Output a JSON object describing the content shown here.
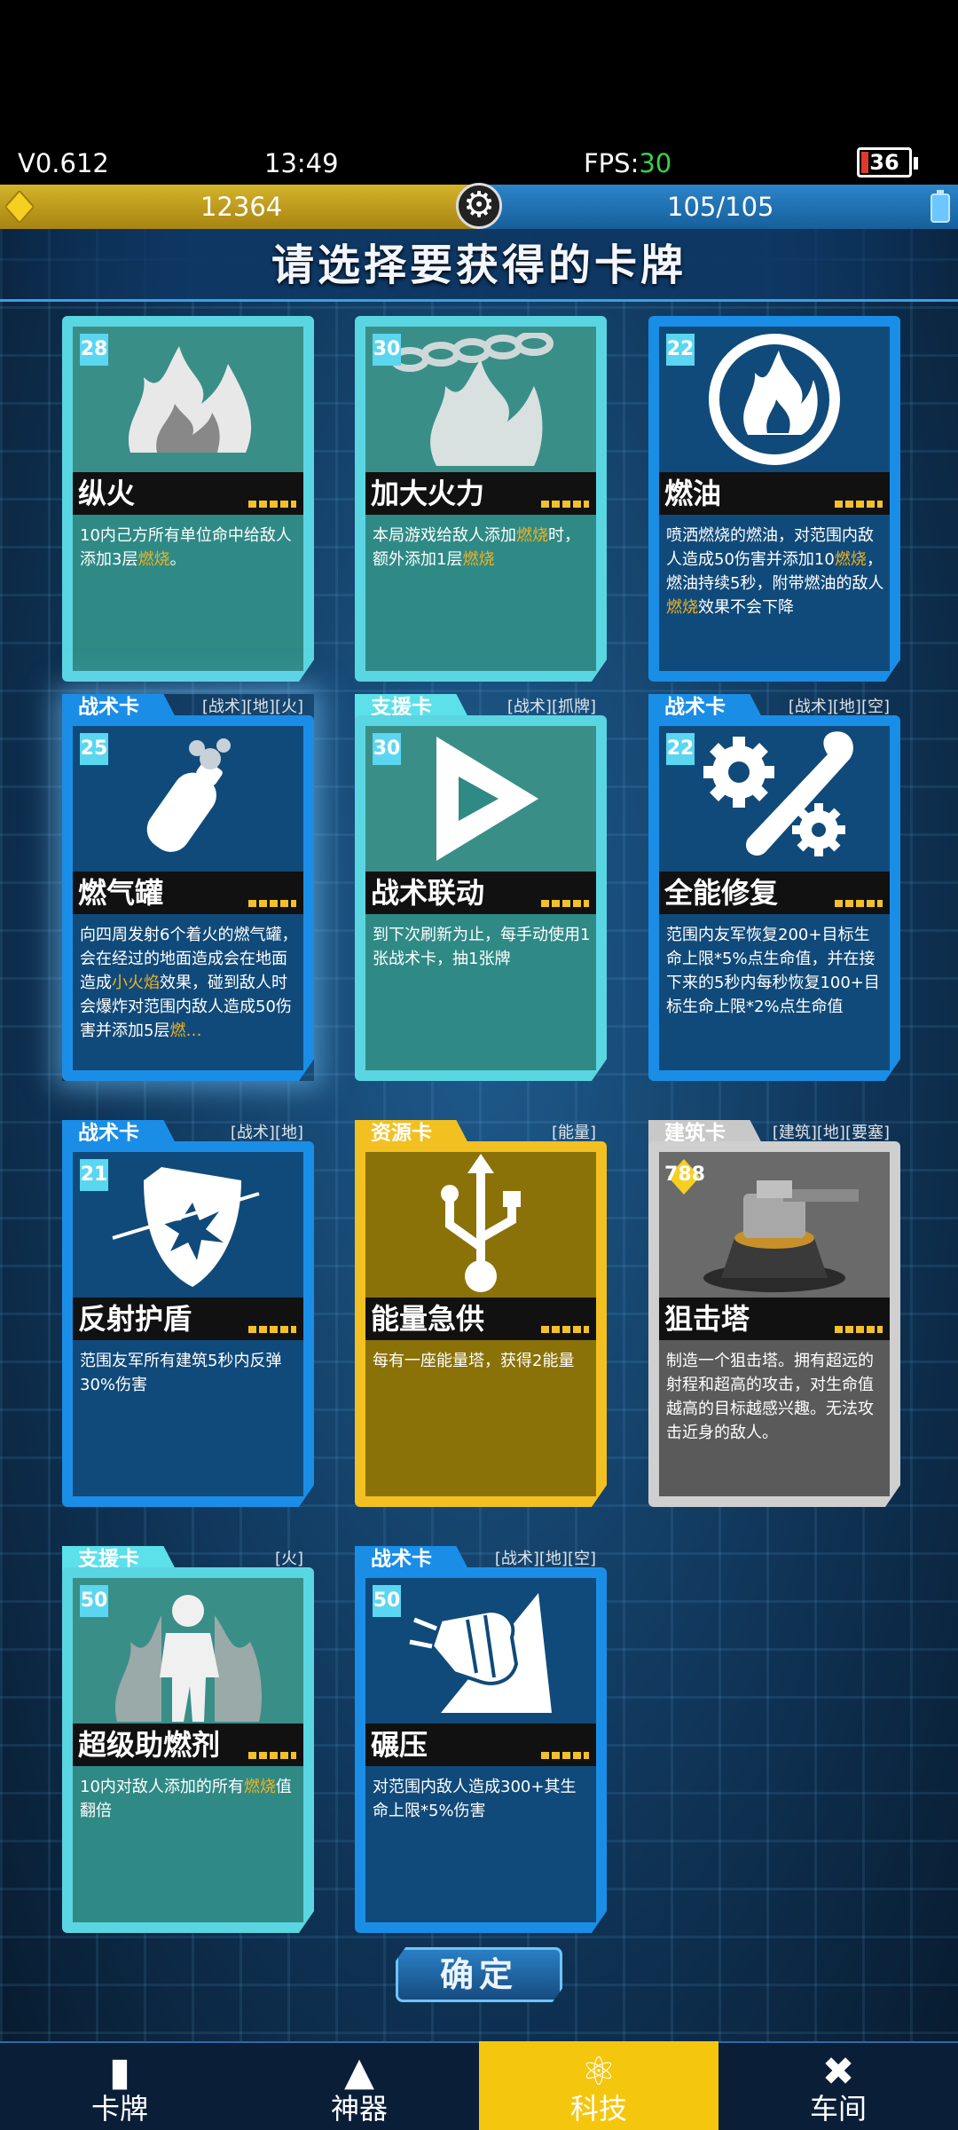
{
  "status": {
    "version": "V0.612",
    "time": "13:49",
    "fps_label": "FPS:",
    "fps_value": "30",
    "battery": "36"
  },
  "resources": {
    "gold": "12364",
    "energy": "105/105"
  },
  "header": {
    "title": "请选择要获得的卡牌"
  },
  "cards": [
    {
      "type": "",
      "tags": "",
      "cost": "28",
      "name": "纵火",
      "desc": [
        {
          "t": "10内己方所有单位命中给敌人添加3层"
        },
        {
          "t": "燃烧",
          "hl": true
        },
        {
          "t": "。"
        }
      ],
      "style": "cyan",
      "icon": "fire-icon"
    },
    {
      "type": "",
      "tags": "",
      "cost": "30",
      "name": "加大火力",
      "desc": [
        {
          "t": "本局游戏给敌人添加"
        },
        {
          "t": "燃烧",
          "hl": true
        },
        {
          "t": "时，额外添加1层"
        },
        {
          "t": "燃烧",
          "hl": true
        }
      ],
      "style": "cyan",
      "icon": "chain-fire-icon"
    },
    {
      "type": "",
      "tags": "",
      "cost": "22",
      "name": "燃油",
      "desc": [
        {
          "t": "喷洒燃烧的燃油，对范围内敌人造成50伤害并添加10"
        },
        {
          "t": "燃烧",
          "hl": true
        },
        {
          "t": "，燃油持续5秒，附带燃油的敌人"
        },
        {
          "t": "燃烧",
          "hl": true
        },
        {
          "t": "效果不会下降"
        }
      ],
      "style": "blu",
      "icon": "flame-circle-icon"
    },
    {
      "type": "战术卡",
      "tags": "[战术][地][火]",
      "cost": "25",
      "name": "燃气罐",
      "desc": [
        {
          "t": "向四周发射6个着火的燃气罐，会在经过的地面造成会在地面造成"
        },
        {
          "t": "小火焰",
          "hl": true
        },
        {
          "t": "效果，碰到敌人时会爆炸对范围内敌人造成50伤害并添加5层"
        },
        {
          "t": "燃…",
          "hl": true
        }
      ],
      "style": "blu",
      "icon": "gas-canister-icon"
    },
    {
      "type": "支援卡",
      "tags": "[战术][抓牌]",
      "cost": "30",
      "name": "战术联动",
      "desc": [
        {
          "t": "到下次刷新为止，每手动使用1张战术卡，抽1张牌"
        }
      ],
      "style": "cyan",
      "icon": "arrow-icon"
    },
    {
      "type": "战术卡",
      "tags": "[战术][地][空]",
      "cost": "22",
      "name": "全能修复",
      "desc": [
        {
          "t": "范围内友军恢复200+目标生命上限*5%点生命值，并在接下来的5秒内每秒恢复100+目标生命上限*2%点生命值"
        }
      ],
      "style": "blu",
      "icon": "wrench-gear-icon"
    },
    {
      "type": "战术卡",
      "tags": "[战术][地]",
      "cost": "21",
      "name": "反射护盾",
      "desc": [
        {
          "t": "范围友军所有建筑5秒内反弹30%伤害"
        }
      ],
      "style": "blu",
      "icon": "shield-icon"
    },
    {
      "type": "资源卡",
      "tags": "[能量]",
      "cost": "",
      "name": "能量急供",
      "desc": [
        {
          "t": "每有一座能量塔，获得2能量"
        }
      ],
      "style": "yel",
      "icon": "usb-icon"
    },
    {
      "type": "建筑卡",
      "tags": "[建筑][地][要塞]",
      "cost": "788",
      "name": "狙击塔",
      "desc": [
        {
          "t": "制造一个狙击塔。拥有超远的射程和超高的攻击，对生命值越高的目标越感兴趣。无法攻击近身的敌人。"
        }
      ],
      "style": "gry",
      "icon": "turret-icon"
    },
    {
      "type": "支援卡",
      "tags": "[火]",
      "cost": "50",
      "name": "超级助燃剂",
      "desc": [
        {
          "t": "10内对敌人添加的所有"
        },
        {
          "t": "燃烧",
          "hl": true
        },
        {
          "t": "值翻倍"
        }
      ],
      "style": "cyan",
      "icon": "burning-man-icon"
    },
    {
      "type": "战术卡",
      "tags": "[战术][地][空]",
      "cost": "50",
      "name": "碾压",
      "desc": [
        {
          "t": "对范围内敌人造成300+其生命上限*5%伤害"
        }
      ],
      "style": "blu",
      "icon": "fist-icon"
    }
  ],
  "confirm": "确定",
  "nav": [
    {
      "label": "卡牌",
      "icon": "cards-icon"
    },
    {
      "label": "神器",
      "icon": "artifact-icon"
    },
    {
      "label": "科技",
      "icon": "atom-icon",
      "active": true
    },
    {
      "label": "车间",
      "icon": "workshop-icon"
    }
  ]
}
